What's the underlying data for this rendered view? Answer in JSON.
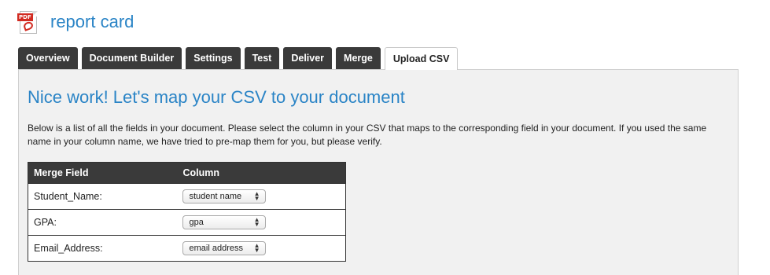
{
  "header": {
    "title": "report card",
    "icon": "pdf-document-icon",
    "icon_badge": "PDF"
  },
  "tabs": [
    {
      "label": "Overview",
      "active": false
    },
    {
      "label": "Document Builder",
      "active": false
    },
    {
      "label": "Settings",
      "active": false
    },
    {
      "label": "Test",
      "active": false
    },
    {
      "label": "Deliver",
      "active": false
    },
    {
      "label": "Merge",
      "active": false
    },
    {
      "label": "Upload CSV",
      "active": true
    }
  ],
  "main": {
    "heading": "Nice work! Let's map your CSV to your document",
    "description": "Below is a list of all the fields in your document. Please select the column in your CSV that maps to the corresponding field in your document. If you used the same name in your column name, we have tried to pre-map them for you, but please verify."
  },
  "mapping_table": {
    "headers": [
      "Merge Field",
      "Column"
    ],
    "rows": [
      {
        "field": "Student_Name:",
        "column": "student name"
      },
      {
        "field": "GPA:",
        "column": "gpa"
      },
      {
        "field": "Email_Address:",
        "column": "email address"
      }
    ]
  },
  "colors": {
    "accent": "#2a84c6",
    "tab_bg": "#3a3a3a",
    "panel_bg": "#f1f1f1",
    "pdf_red": "#d22b21"
  }
}
